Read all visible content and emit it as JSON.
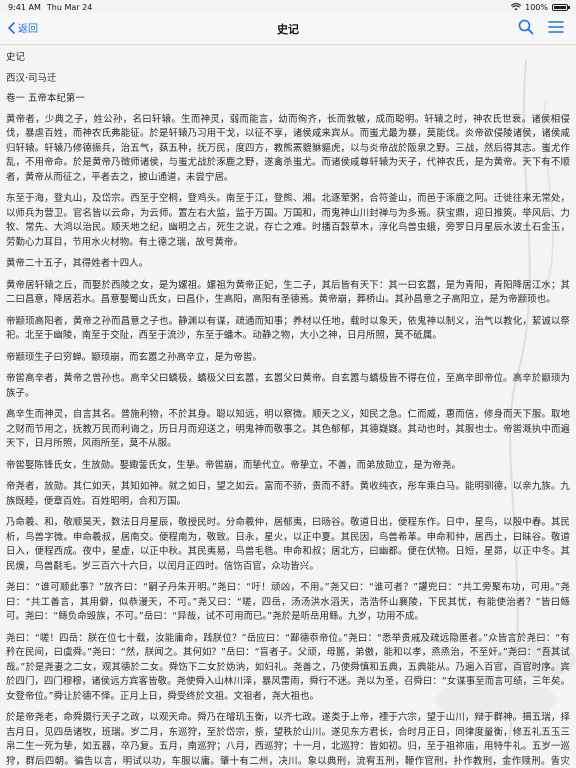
{
  "status": {
    "time": "9:41 AM",
    "date": "Thu Mar 24",
    "battery": "100%",
    "battery_level": 1.0
  },
  "nav": {
    "back_label": "返回",
    "title": "史记"
  },
  "book": {
    "title": "史记",
    "author": "西汉·司马迁",
    "chapter": "卷一 五帝本纪第一"
  },
  "paragraphs": [
    "黄帝者，少典之子，姓公孙，名曰轩辕。生而神灵，弱而能言，幼而徇齐，长而敦敏，成而聪明。轩辕之时，神农氏世衰。诸侯相侵伐，暴虐百姓，而神农氏弗能征。於是轩辕乃习用干戈，以征不享，诸侯咸来宾从。而蚩尤最为暴，莫能伐。炎帝欲侵陵诸侯，诸侯咸归轩辕。轩辕乃修德振兵，治五气，蓺五种，抚万民，度四方，教熊罴貔貅貙虎，以与炎帝战於阪泉之野。三战，然后得其志。蚩尤作乱，不用帝命。於是黄帝乃徵师诸侯，与蚩尤战於涿鹿之野，遂禽杀蚩尤。而诸侯咸尊轩辕为天子，代神农氏，是为黄帝。天下有不顺者，黄帝从而征之，平者去之，披山通道，未尝宁居。",
    "东至于海，登丸山，及岱宗。西至于空桐，登鸡头。南至于江，登熊、湘。北逐荤粥，合符釜山，而邑于涿鹿之阿。迁徙往来无常处，以师兵为营卫。官名皆以云命，为云师。置左右大监，监于万国。万国和，而鬼神山川封禅与为多焉。获宝鼎，迎日推筴。举风后、力牧、常先、大鸿以治民。顺天地之纪，幽明之占，死生之说，存亡之难。时播百穀草木，淳化鸟兽虫蛾，旁罗日月星辰水波土石金玉，劳勤心力耳目，节用水火材物。有土德之瑞，故号黄帝。",
    "黄帝二十五子，其得姓者十四人。",
    "黄帝居轩辕之丘，而娶於西陵之女，是为嫘祖。嫘祖为黄帝正妃，生二子，其后皆有天下：其一曰玄嚣，是为青阳，青阳降居江水；其二曰昌意，降居若水。昌意娶蜀山氏女，曰昌仆，生高阳，高阳有圣德焉。黄帝崩，葬桥山。其孙昌意之子高阳立，是为帝颛顼也。",
    "帝颛顼高阳者，黄帝之孙而昌意之子也。静渊以有谋，疏通而知事；养材以任地，载时以象天，依鬼神以制义，治气以教化，絜诚以祭祀。北至于幽陵，南至于交阯，西至于流沙，东至于蟠木。动静之物，大小之神，日月所照，莫不砥属。",
    "帝颛顼生子曰穷蝉。颛顼崩，而玄嚣之孙高辛立，是为帝喾。",
    "帝喾高辛者，黄帝之曾孙也。高辛父曰蟜极，蟜极父曰玄嚣，玄嚣父曰黄帝。自玄嚣与蟜极皆不得在位，至高辛即帝位。高辛於颛顼为族子。",
    "高辛生而神灵，自言其名。普施利物，不於其身。聪以知远，明以察微。顺天之义，知民之急。仁而威，惠而信，修身而天下服。取地之财而节用之，抚教万民而利诲之，历日月而迎送之，明鬼神而敬事之。其色郁郁，其德嶷嶷。其动也时，其服也士。帝喾溉执中而遍天下，日月所照，风雨所至，莫不从服。",
    "帝喾娶陈锋氏女，生放勋。娶娵訾氏女，生挚。帝喾崩，而挚代立。帝挚立，不善，而弟放勋立，是为帝尧。",
    "帝尧者，放勋。其仁如天，其知如神。就之如日，望之如云。富而不骄，贵而不舒。黄收纯衣，彤车乘白马。能明驯德，以亲九族。九族既睦，便章百姓。百姓昭明，合和万国。",
    "乃命羲、和，敬顺昊天，数法日月星辰，敬授民时。分命羲仲，居郁夷，曰旸谷。敬道日出，便程东作。日中，星鸟，以殷中春。其民析，鸟兽字微。申命羲叔，居南交。便程南为，敬致。日永，星火，以正中夏。其民因，鸟兽希革。申命和仲，居西土，曰昧谷。敬道日入，便程西成。夜中，星虚，以正中秋。其民夷易，鸟兽毛毨。申命和叔；居北方，曰幽都。便在伏物。日短，星昴，以正中冬。其民燠，鸟兽氄毛。岁三百六十六日，以闰月正四时。信饬百官，众功皆兴。",
    "尧曰：“谁可顺此事？”放齐曰：“嗣子丹朱开明。”尧曰：“吁！顽凶，不用。”尧又曰：“谁可者？”讙兜曰：“共工旁聚布功，可用。”尧曰：“共工善言，其用僻，似恭漫天，不可。”尧又曰：“嗟，四岳，汤汤洪水滔天，浩浩怀山襄陵，下民其忧，有能使治者？”皆曰鲧可。尧曰：“鲧负命毁族，不可。”岳曰：“异哉，试不可用而已。”尧於是听岳用鲧。九岁，功用不成。",
    "尧曰：“嗟！四岳：朕在位七十载，汝能庸命，践朕位？”岳应曰：“鄙德忝帝位。”尧曰：“悉举贵戚及疏远隐匿者。”众皆言於尧曰：“有矜在民间，曰虞舜。”尧曰：“然，朕闻之。其何如？”岳曰：“盲者子。父顽，母嚚，弟傲，能和以孝，烝烝治，不至奸。”尧曰：“吾其试哉。”於是尧妻之二女，观其德於二女。舜饬下二女於妫汭，如妇礼。尧善之，乃使舜慎和五典，五典能从。乃遍入百官，百官时序。宾於四门，四门穆穆，诸侯远方宾客皆敬。尧使舜入山林川泽，暴风雷雨，舜行不迷。尧以为圣，召舜曰：“女谋事至而言可绩，三年矣。女登帝位。”舜让於德不怿。正月上日，舜受终於文祖。文祖者，尧大祖也。",
    "於是帝尧老，命舜摄行天子之政，以观天命。舜乃在璿玑玉衡，以齐七政。遂类于上帝，禋于六宗，望于山川，辩于群神。揖五瑞，择吉月日，见四岳诸牧，班瑞。岁二月，东巡狩，至於岱宗，祡，望秩於山川。遂见东方君长，合时月正日，同律度量衡，修五礼五玉三帛二生一死为挚，如五器，卒乃复。五月，南巡狩；八月，西巡狩；十一月，北巡狩：皆如初。归，至于祖祢庙，用特牛礼。五岁一巡狩，群后四朝。徧告以言，明试以功，车服以庸。肇十有二州，决川。象以典刑，流宥五刑，鞭作官刑，扑作教刑，金作赎刑。眚灾过，赦；怙终贼，刑。钦哉，钦哉，惟刑之静哉！"
  ]
}
